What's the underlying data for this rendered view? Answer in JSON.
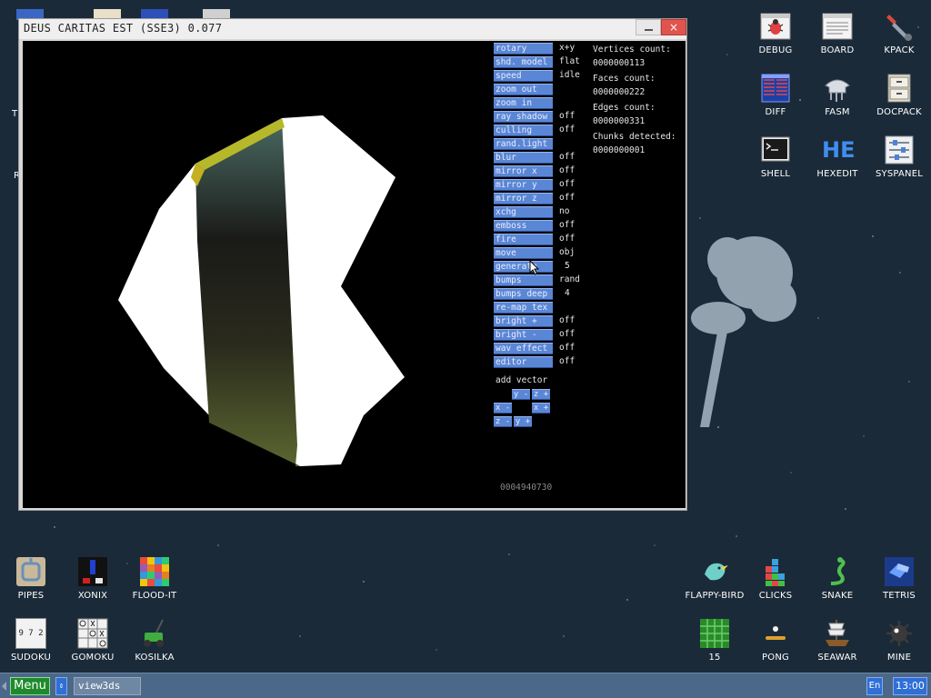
{
  "window": {
    "title": "DEUS CARITAS EST (SSE3) 0.077",
    "close_glyph": "×",
    "controls": [
      {
        "label": "rotary",
        "value": "x+y"
      },
      {
        "label": "shd. model",
        "value": "flat"
      },
      {
        "label": "speed",
        "value": "idle"
      },
      {
        "label": "zoom out",
        "value": ""
      },
      {
        "label": "zoom in",
        "value": ""
      },
      {
        "label": "ray shadow",
        "value": "off"
      },
      {
        "label": "culling",
        "value": "off"
      },
      {
        "label": "rand.light",
        "value": ""
      },
      {
        "label": "blur",
        "value": "off"
      },
      {
        "label": "mirror x",
        "value": "off"
      },
      {
        "label": "mirror y",
        "value": "off"
      },
      {
        "label": "mirror z",
        "value": "off"
      },
      {
        "label": "xchg",
        "value": "no"
      },
      {
        "label": "emboss",
        "value": "off"
      },
      {
        "label": "fire",
        "value": "off"
      },
      {
        "label": "move",
        "value": "obj"
      },
      {
        "label": "generate",
        "value": "5"
      },
      {
        "label": "bumps",
        "value": "rand"
      },
      {
        "label": "bumps deep",
        "value": "4"
      },
      {
        "label": "re-map tex",
        "value": ""
      },
      {
        "label": "bright +",
        "value": "off"
      },
      {
        "label": "bright -",
        "value": "off"
      },
      {
        "label": "wav effect",
        "value": "off"
      },
      {
        "label": "editor",
        "value": "off"
      }
    ],
    "stats": {
      "vertices_label": "Vertices count:",
      "vertices_value": "0000000113",
      "faces_label": "Faces count:",
      "faces_value": "0000000222",
      "edges_label": "Edges count:",
      "edges_value": "0000000331",
      "chunks_label": "Chunks detected:",
      "chunks_value": "0000000001"
    },
    "add_vector": {
      "label": "add vector",
      "y_minus": "y -",
      "z_plus": "z +",
      "x_minus": "x -",
      "x_plus": "x +",
      "z_minus": "z -",
      "y_plus": "y +"
    },
    "counter": "0004940730"
  },
  "desktop_icons_right": [
    {
      "label": "DEBUG",
      "icon": "debug-bug-icon"
    },
    {
      "label": "BOARD",
      "icon": "board-icon"
    },
    {
      "label": "KPACK",
      "icon": "kpack-wrench-icon"
    },
    {
      "label": "DIFF",
      "icon": "diff-icon"
    },
    {
      "label": "FASM",
      "icon": "fasm-icon"
    },
    {
      "label": "DOCPACK",
      "icon": "docpack-cabinet-icon"
    },
    {
      "label": "SHELL",
      "icon": "shell-terminal-icon"
    },
    {
      "label": "HEXEDIT",
      "icon": "hexedit-icon"
    },
    {
      "label": "SYSPANEL",
      "icon": "syspanel-sliders-icon"
    }
  ],
  "desktop_icons_bottom": [
    {
      "label": "PIPES",
      "icon": "pipes-icon"
    },
    {
      "label": "XONIX",
      "icon": "xonix-icon"
    },
    {
      "label": "FLOOD-IT",
      "icon": "flood-it-icon"
    },
    {
      "label": "SUDOKU",
      "icon": "sudoku-icon"
    },
    {
      "label": "GOMOKU",
      "icon": "gomoku-icon"
    },
    {
      "label": "KOSILKA",
      "icon": "kosilka-mower-icon"
    },
    {
      "label": "FLAPPY-BIRD",
      "icon": "flappy-bird-icon"
    },
    {
      "label": "CLICKS",
      "icon": "clicks-icon"
    },
    {
      "label": "SNAKE",
      "icon": "snake-icon"
    },
    {
      "label": "TETRIS",
      "icon": "tetris-icon"
    },
    {
      "label": "15",
      "icon": "fifteen-puzzle-icon"
    },
    {
      "label": "PONG",
      "icon": "pong-icon"
    },
    {
      "label": "SEAWAR",
      "icon": "seawar-ship-icon"
    },
    {
      "label": "MINE",
      "icon": "mine-icon"
    }
  ],
  "hexedit_glyph": "HE",
  "sudoku_glyphs": "9 7 2",
  "taskbar": {
    "menu_label": "Menu",
    "switch_glyph": "⇕",
    "task_label": "view3ds",
    "lang": "En",
    "clock": "13:00"
  },
  "colors": {
    "desktop_bg": "#1b2a38",
    "taskbar_bg": "#4b6888",
    "control_button": "#5a86d6",
    "menu_button": "#1f8a2c",
    "close_button": "#e0544d"
  }
}
